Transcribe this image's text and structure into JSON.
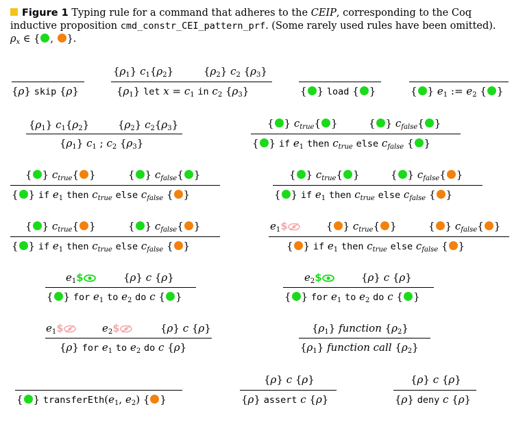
{
  "caption": {
    "label": "Figure 1",
    "text_a": "Typing rule for a command that adheres to the",
    "ceip": "CEIP",
    "text_b": ", corresponding to the Coq inductive proposition",
    "code": "cmd_constr_CEI_pattern_prf",
    "text_c": ". (Some rarely used rules have been omitted).",
    "rho_set": "ρx ∈ {●, ●}."
  },
  "colors": {
    "green": "#1adb1a",
    "orange": "#f3810d",
    "accent": "#f6c21a",
    "faded": "#f3a9a9"
  },
  "rules": {
    "skip": {
      "conclusion": "{ρ} skip {ρ}"
    },
    "let": {
      "premise1": "{ρ1} c1{ρ2}",
      "premise2": "{ρ2} c2 {ρ3}",
      "conclusion": "{ρ1} let x = c1 in c2 {ρ3}"
    },
    "load": {
      "conclusion": "{●} load {●}"
    },
    "assign": {
      "conclusion": "{●} e1 := e2 {●}"
    },
    "seq": {
      "premise1": "{ρ1} c1{ρ2}",
      "premise2": "{ρ2} c2{ρ3}",
      "conclusion": "{ρ1} c1 ; c2 {ρ3}"
    },
    "transfer": {
      "conclusion": "{●} transferEth(e1, e2) {●}"
    },
    "assert": {
      "premise": "{ρ} c {ρ}",
      "conclusion": "{ρ} assert c {ρ}"
    },
    "deny": {
      "premise": "{ρ} c {ρ}",
      "conclusion": "{ρ} deny c {ρ}"
    },
    "function": {
      "premise": "{ρ1} function {ρ2}",
      "conclusion": "{ρ1} function call {ρ2}"
    }
  }
}
